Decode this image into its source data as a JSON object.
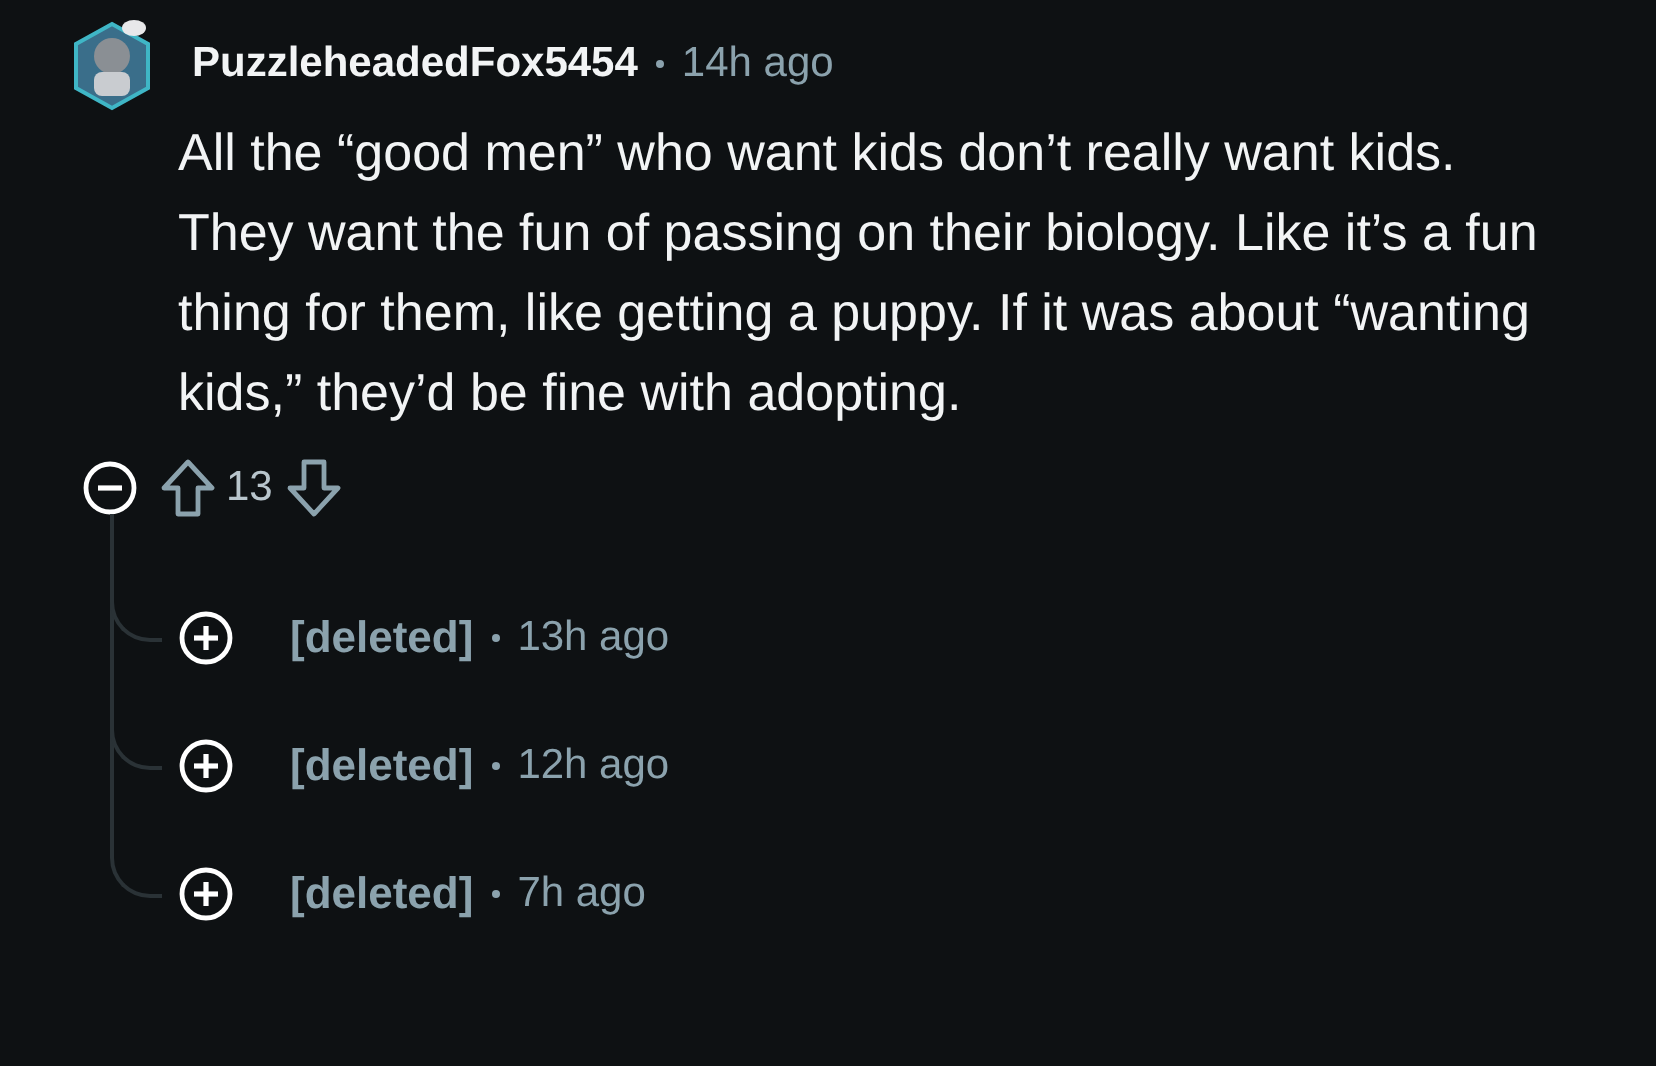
{
  "comment": {
    "author": "PuzzleheadedFox5454",
    "time": "14h ago",
    "body": "All the “good men” who want kids don’t really want kids. They want the fun of passing on their biology. Like it’s a fun thing for them, like getting a puppy. If it was about “wanting kids,” they’d be fine with adopting.",
    "score": "13",
    "expanded": true
  },
  "replies": [
    {
      "author": "[deleted]",
      "time": "13h ago",
      "expanded": false
    },
    {
      "author": "[deleted]",
      "time": "12h ago",
      "expanded": false
    },
    {
      "author": "[deleted]",
      "time": "7h ago",
      "expanded": false
    }
  ]
}
